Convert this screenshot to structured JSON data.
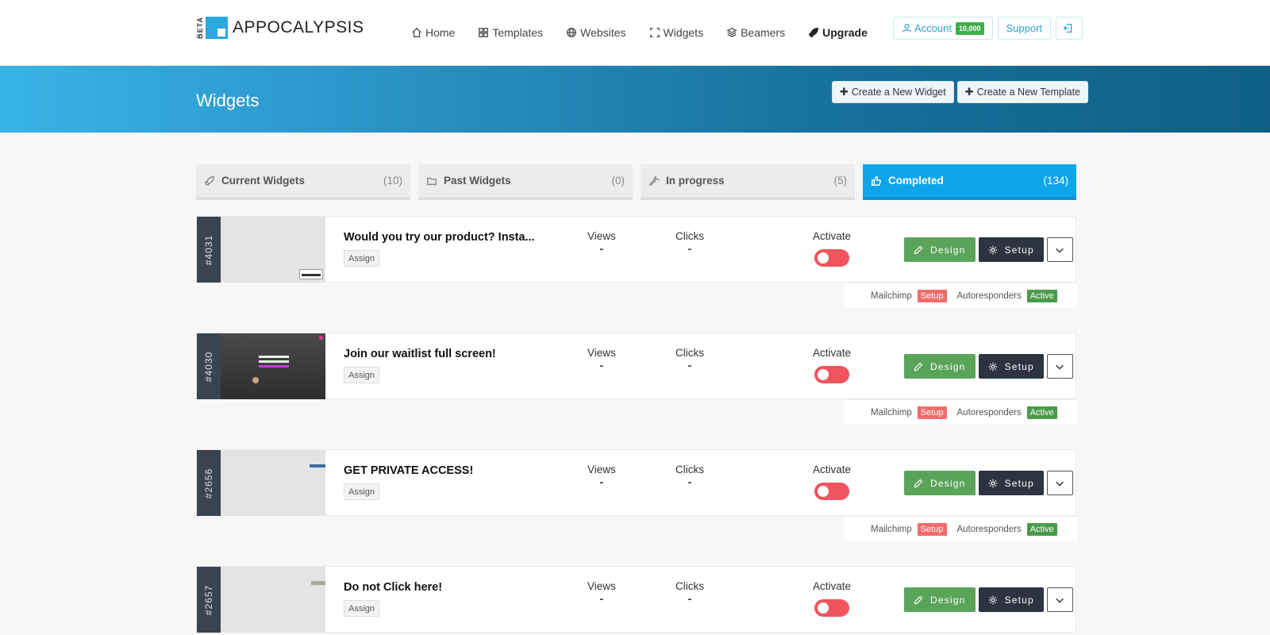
{
  "app": {
    "beta_label": "BETA",
    "name": "APPOCALYPSIS"
  },
  "nav": {
    "items": [
      {
        "label": "Home",
        "icon": "home-icon"
      },
      {
        "label": "Templates",
        "icon": "grid-icon"
      },
      {
        "label": "Websites",
        "icon": "globe-icon"
      },
      {
        "label": "Widgets",
        "icon": "expand-icon"
      },
      {
        "label": "Beamers",
        "icon": "layers-icon"
      },
      {
        "label": "Upgrade",
        "icon": "rocket-icon"
      }
    ]
  },
  "top_actions": {
    "account_label": "Account",
    "account_badge": "10,000",
    "support_label": "Support"
  },
  "banner": {
    "title": "Widgets",
    "create_widget": "Create a New Widget",
    "create_template": "Create a New Template"
  },
  "tabs": [
    {
      "label": "Current Widgets",
      "count": "(10)",
      "icon": "rocket-icon"
    },
    {
      "label": "Past Widgets",
      "count": "(0)",
      "icon": "folder-icon"
    },
    {
      "label": "In progress",
      "count": "(5)",
      "icon": "wrench-icon"
    },
    {
      "label": "Completed",
      "count": "(134)",
      "icon": "thumbs-up-icon",
      "active": true
    }
  ],
  "widgets": [
    {
      "id": "#4031",
      "title": "Would you try our product? Insta...",
      "assign": "Assign",
      "views_label": "Views",
      "views": "-",
      "clicks_label": "Clicks",
      "clicks": "-",
      "activate_label": "Activate",
      "design": "Design",
      "setup": "Setup"
    },
    {
      "id": "#4030",
      "title": "Join our waitlist full screen!",
      "assign": "Assign",
      "views_label": "Views",
      "views": "-",
      "clicks_label": "Clicks",
      "clicks": "-",
      "activate_label": "Activate",
      "design": "Design",
      "setup": "Setup"
    },
    {
      "id": "#2656",
      "title": "GET PRIVATE ACCESS!",
      "assign": "Assign",
      "views_label": "Views",
      "views": "-",
      "clicks_label": "Clicks",
      "clicks": "-",
      "activate_label": "Activate",
      "design": "Design",
      "setup": "Setup"
    },
    {
      "id": "#2657",
      "title": "Do not Click here!",
      "assign": "Assign",
      "views_label": "Views",
      "views": "-",
      "clicks_label": "Clicks",
      "clicks": "-",
      "activate_label": "Activate",
      "design": "Design",
      "setup": "Setup"
    }
  ],
  "integrations": {
    "mailchimp": "Mailchimp",
    "mailchimp_status": "Setup",
    "autoresponders": "Autoresponders",
    "autoresponders_status": "Active"
  },
  "colors": {
    "accent": "#0ea5ea",
    "design_button": "#5aa45a",
    "setup_button": "#2d3340",
    "toggle_off": "#f0545c",
    "status_setup": "#f26b6b",
    "status_active": "#4a9a4a"
  }
}
